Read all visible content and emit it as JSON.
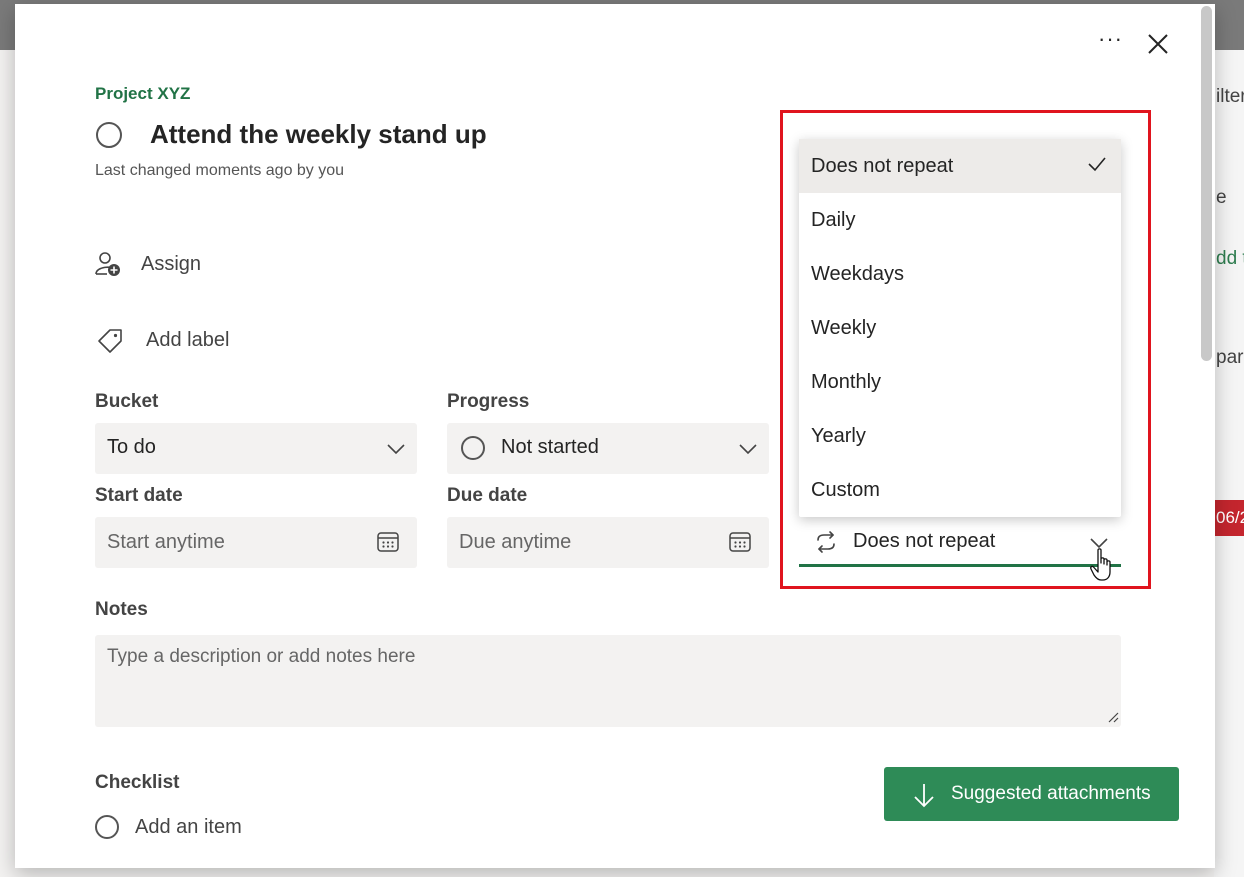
{
  "background": {
    "fragments": [
      "ilter",
      "e",
      "dd t",
      "par"
    ],
    "date_badge": "06/2"
  },
  "header": {
    "more_icon": "more-horizontal-icon",
    "more_glyph": "···",
    "close_icon": "close-icon"
  },
  "task": {
    "project": "Project XYZ",
    "title": "Attend the weekly stand up",
    "last_changed": "Last changed moments ago by you"
  },
  "actions": {
    "assign": "Assign",
    "add_label": "Add label"
  },
  "fields": {
    "bucket_label": "Bucket",
    "bucket_value": "To do",
    "progress_label": "Progress",
    "progress_value": "Not started",
    "start_label": "Start date",
    "start_placeholder": "Start anytime",
    "due_label": "Due date",
    "due_placeholder": "Due anytime"
  },
  "repeat": {
    "current": "Does not repeat",
    "options": [
      "Does not repeat",
      "Daily",
      "Weekdays",
      "Weekly",
      "Monthly",
      "Yearly",
      "Custom"
    ],
    "selected_index": 0
  },
  "notes": {
    "label": "Notes",
    "placeholder": "Type a description or add notes here"
  },
  "checklist": {
    "label": "Checklist",
    "add_item": "Add an item"
  },
  "buttons": {
    "suggested_attachments": "Suggested attachments"
  },
  "colors": {
    "accent_green": "#217346",
    "button_green": "#2e8b57",
    "highlight_red": "#e0141e"
  }
}
